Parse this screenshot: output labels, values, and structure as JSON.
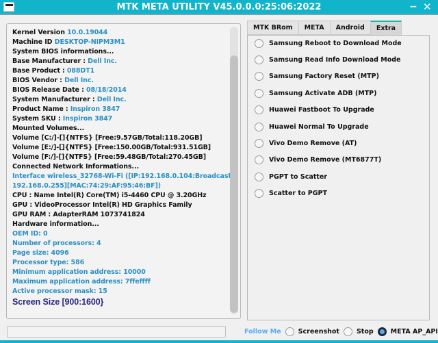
{
  "window": {
    "title": "MTK META UTILITY V45.0.0.0:25:06:2022",
    "minimize": "−",
    "close": "✕"
  },
  "info_lines": [
    {
      "label": "Kernel Version ",
      "value": "10.0.19044"
    },
    {
      "label": "Machine ID ",
      "value": "DESKTOP-NIPM3M1"
    },
    {
      "label": "System BIOS informations...",
      "value": ""
    },
    {
      "label": "Base Manufacturer : ",
      "value": "Dell Inc."
    },
    {
      "label": "Base Product : ",
      "value": "088DT1"
    },
    {
      "label": "BIOS Vendor : ",
      "value": "Dell Inc."
    },
    {
      "label": "BIOS Release Date : ",
      "value": "08/18/2014"
    },
    {
      "label": "System Manufacturer : ",
      "value": "Dell Inc."
    },
    {
      "label": "Product Name : ",
      "value": "Inspiron 3847"
    },
    {
      "label": "System SKU : ",
      "value": "Inspiron 3847"
    },
    {
      "label": "Mounted Volumes...",
      "value": ""
    },
    {
      "label": "Volume [C:/]-[]{NTFS} [Free:9.57GB/Total:118.20GB]",
      "value": ""
    },
    {
      "label": "Volume [E:/]-[]{NTFS} [Free:150.00GB/Total:931.51GB]",
      "value": ""
    },
    {
      "label": "Volume [F:/]-[]{NTFS} [Free:59.48GB/Total:270.45GB]",
      "value": ""
    },
    {
      "label": "Connected Network Informations...",
      "value": ""
    }
  ],
  "network_lines": [
    "Interface wireless_32768-Wi-Fi ([IP:192.168.0.104:Broadcast:",
    "192.168.0.255][MAC:74:29:AF:95:46:BF])"
  ],
  "hw_lines": [
    "CPU  : Name Intel(R) Core(TM) i5-4460 CPU @ 3.20GHz",
    "GPU  : VideoProcessor Intel(R) HD Graphics Family",
    "GPU RAM  : AdapterRAM 1073741824",
    "Hardware information..."
  ],
  "hw_blue_lines": [
    "OEM ID: 0",
    "Number of processors: 4",
    "Page size: 4096",
    "Processor type: 586",
    "Minimum application address: 10000",
    "Maximum application address: 7ffeffff",
    "Active processor mask: 15"
  ],
  "screen_size": "Screen Size [900:1600}",
  "tabs": [
    "MTK BRom",
    "META",
    "Android",
    "Extra"
  ],
  "active_tab": "Extra",
  "extra_options": [
    "Samsung Reboot to Download Mode",
    "Samsung Read Info Download Mode",
    "Samsung Factory Reset (MTP)",
    "Samsung Activate ADB (MTP)",
    "Huawei Fastboot To Upgrade",
    "Huawei Normal To Upgrade",
    "Vivo Demo Remove (AT)",
    "Vivo Demo Remove (MT6877T)",
    "PGPT to Scatter",
    "Scatter to PGPT"
  ],
  "footer": {
    "follow_me": "Follow Me",
    "screenshot": "Screenshot",
    "stop": "Stop",
    "meta_ap_api": "META AP_API",
    "selected": "META AP_API"
  },
  "progress": 0,
  "colors": {
    "titlebar": "#10b5cc",
    "value_text": "#2b8fc4",
    "tab_accent": "#1bb8a8"
  }
}
